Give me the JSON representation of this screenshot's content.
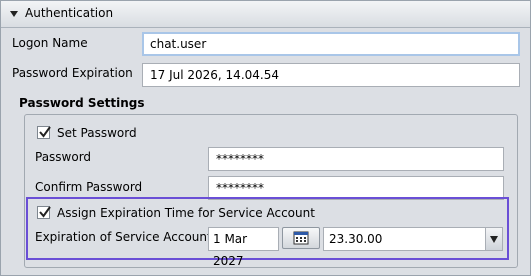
{
  "header": {
    "title": "Authentication"
  },
  "fields": {
    "logon_name_label": "Logon Name",
    "logon_name_value": "chat.user",
    "password_expiration_label": "Password Expiration",
    "password_expiration_value": "17 Jul 2026, 14.04.54"
  },
  "password_settings": {
    "title": "Password Settings",
    "set_password_label": "Set Password",
    "set_password_checked": true,
    "password_label": "Password",
    "password_value": "********",
    "confirm_password_label": "Confirm Password",
    "confirm_password_value": "********",
    "assign_expiration_label": "Assign Expiration Time for Service Account",
    "assign_expiration_checked": true,
    "expiration_label": "Expiration of Service Account",
    "expiration_date": "1 Mar 2027",
    "expiration_time": "23.30.00"
  },
  "icons": {
    "collapse": "triangle-down-icon",
    "calendar": "calendar-icon",
    "dropdown": "chevron-down-icon",
    "check": "checkmark-icon"
  },
  "colors": {
    "highlight_border": "#6a4fd6",
    "focus_border": "#a9c6e8"
  }
}
